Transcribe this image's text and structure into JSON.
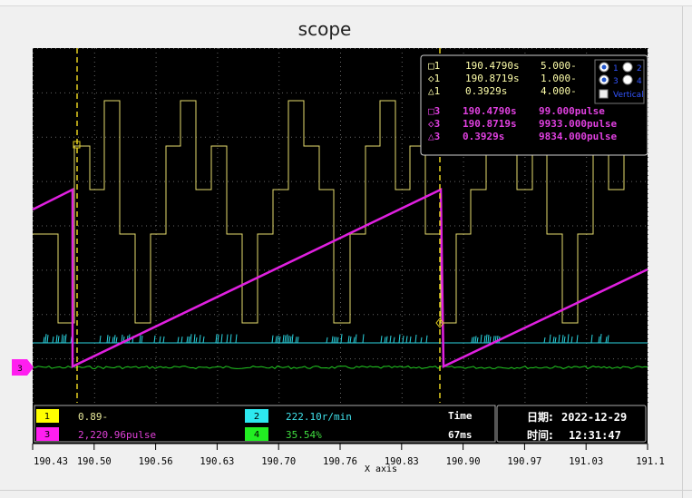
{
  "window": {
    "title": "scope"
  },
  "axis": {
    "xlabel": "X axis",
    "ticks": [
      "190.43",
      "190.50",
      "190.56",
      "190.63",
      "190.70",
      "190.76",
      "190.83",
      "190.90",
      "190.97",
      "191.03",
      "191.1"
    ]
  },
  "cursor_panel": {
    "rows": [
      {
        "sym": "□1",
        "time": "190.4790s",
        "val": "5.000-"
      },
      {
        "sym": "◇1",
        "time": "190.8719s",
        "val": "1.000-"
      },
      {
        "sym": "△1",
        "time": "0.3929s",
        "val": "4.000-"
      }
    ],
    "rows3": [
      {
        "sym": "□3",
        "time": "190.4790s",
        "val": "99.000pulse"
      },
      {
        "sym": "◇3",
        "time": "190.8719s",
        "val": "9933.000pulse"
      },
      {
        "sym": "△3",
        "time": "0.3929s",
        "val": "9834.000pulse"
      }
    ],
    "radio": [
      "1",
      "2",
      "3",
      "4"
    ],
    "vertical": "Vertical"
  },
  "channels": [
    {
      "num": "1",
      "value": "0.89-",
      "color": "#ffff00",
      "text_color": "#e8e89a"
    },
    {
      "num": "2",
      "value": "222.10r/min",
      "color": "#2de8ef",
      "text_color": "#40e0ea"
    },
    {
      "num": "3",
      "value": "2,220.96pulse",
      "color": "#ff1ef0",
      "text_color": "#e040d8"
    },
    {
      "num": "4",
      "value": "35.54%",
      "color": "#22ee22",
      "text_color": "#40dd40"
    }
  ],
  "time": {
    "label": "Time",
    "value": "67ms"
  },
  "datetime": {
    "date_label": "日期:",
    "date": "2022-12-29",
    "time_label": "时间:",
    "time": "12:31:47"
  },
  "marker": {
    "label": "3",
    "color": "#ff1ef0"
  },
  "colors": {
    "ch1": "#e6dc6e",
    "ch2": "#2bd4e0",
    "ch3": "#e020e0",
    "ch4": "#22cc22",
    "cursor": "#e6d020"
  }
}
